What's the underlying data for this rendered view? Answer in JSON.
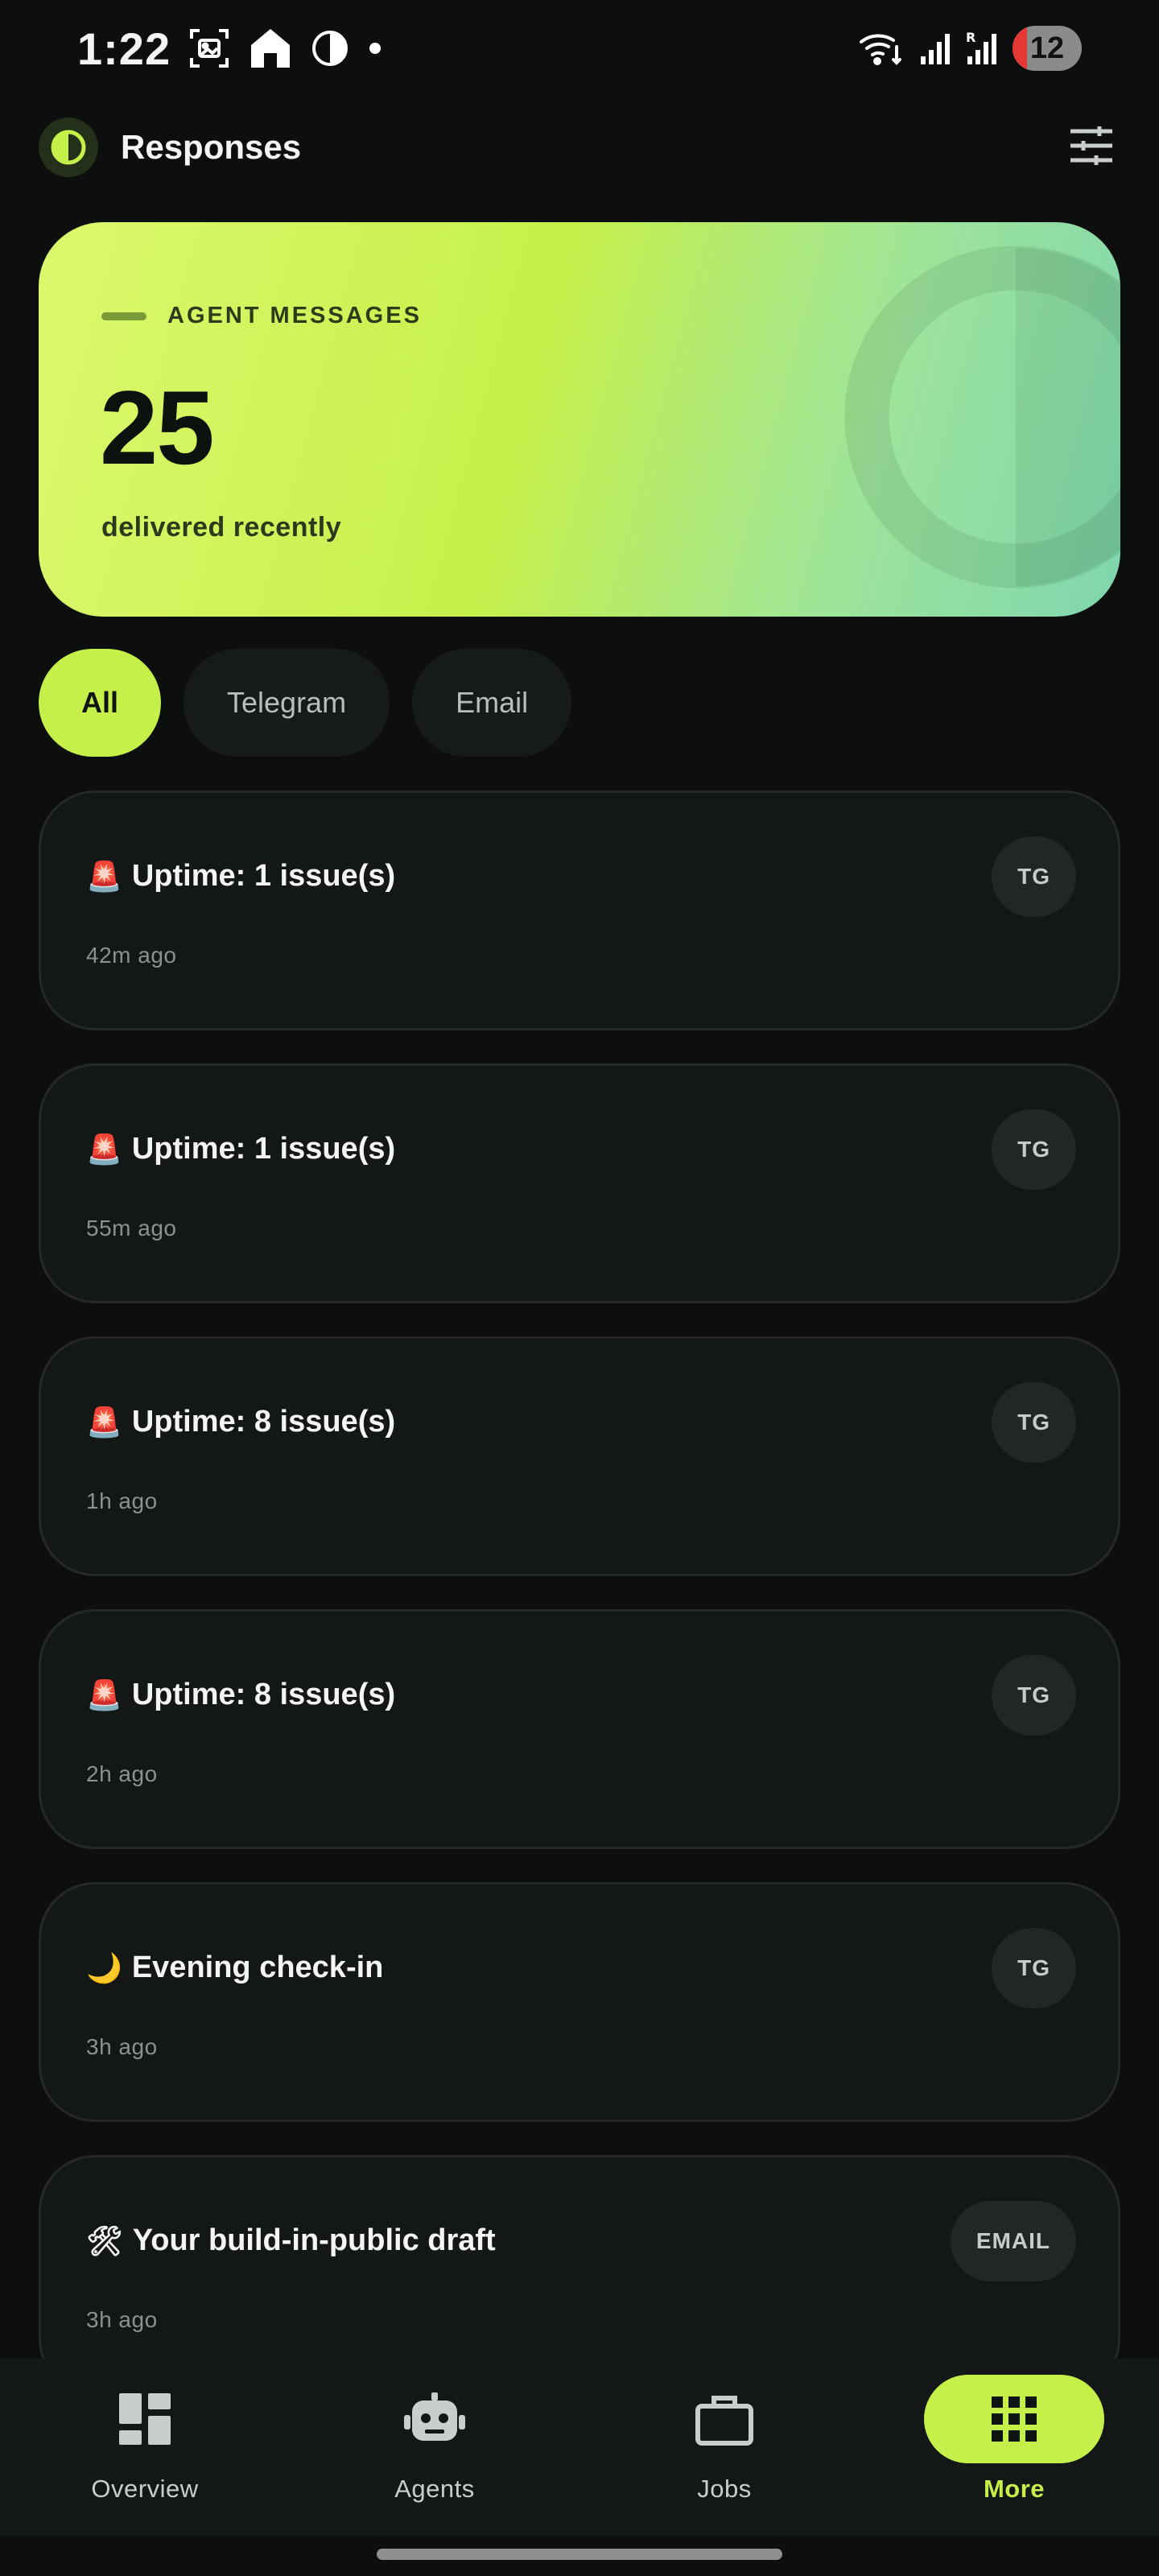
{
  "status_bar": {
    "time": "1:22",
    "battery": "12",
    "icons": [
      "screenshot-icon",
      "home-icon",
      "contrast-icon",
      "dot-icon",
      "wifi-icon",
      "signal-icon",
      "signal-roaming-icon"
    ]
  },
  "app_bar": {
    "title": "Responses",
    "logo_icon": "half-circle-logo-icon",
    "action_icon": "filter-sliders-icon"
  },
  "hero": {
    "label": "AGENT MESSAGES",
    "count": "25",
    "subtitle": "delivered recently"
  },
  "filters": [
    {
      "label": "All",
      "active": true
    },
    {
      "label": "Telegram",
      "active": false
    },
    {
      "label": "Email",
      "active": false
    }
  ],
  "messages": [
    {
      "emoji": "🚨",
      "title": "Uptime: 1 issue(s)",
      "time": "42m ago",
      "badge": "TG"
    },
    {
      "emoji": "🚨",
      "title": "Uptime: 1 issue(s)",
      "time": "55m ago",
      "badge": "TG"
    },
    {
      "emoji": "🚨",
      "title": "Uptime: 8 issue(s)",
      "time": "1h ago",
      "badge": "TG"
    },
    {
      "emoji": "🚨",
      "title": "Uptime: 8 issue(s)",
      "time": "2h ago",
      "badge": "TG"
    },
    {
      "emoji": "🌙",
      "title": "Evening check-in",
      "time": "3h ago",
      "badge": "TG"
    },
    {
      "emoji": "🛠",
      "title": "Your build-in-public draft",
      "time": "3h ago",
      "badge": "EMAIL"
    }
  ],
  "nav": [
    {
      "label": "Overview",
      "icon": "dashboard-icon",
      "active": false
    },
    {
      "label": "Agents",
      "icon": "robot-icon",
      "active": false
    },
    {
      "label": "Jobs",
      "icon": "briefcase-icon",
      "active": false
    },
    {
      "label": "More",
      "icon": "grid-icon",
      "active": true
    }
  ],
  "colors": {
    "accent": "#c5f04a",
    "background": "#0c0f0e",
    "card": "#131716"
  }
}
